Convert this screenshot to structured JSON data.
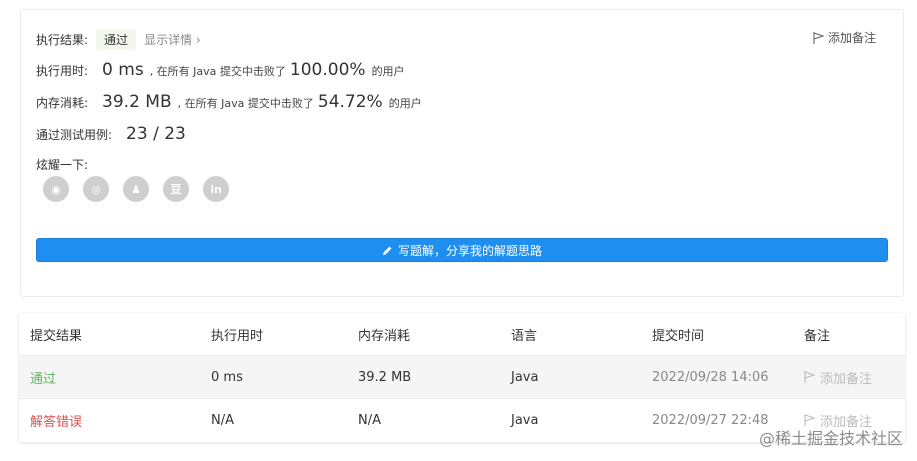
{
  "result": {
    "status_label": "执行结果:",
    "status_value": "通过",
    "details_link": "显示详情 ›",
    "add_note": "添加备注",
    "runtime_label": "执行用时:",
    "runtime_value": "0 ms",
    "runtime_beat_prefix": ", 在所有 Java 提交中击败了",
    "runtime_pct": "100.00%",
    "runtime_suffix": "的用户",
    "memory_label": "内存消耗:",
    "memory_value": "39.2 MB",
    "memory_beat_prefix": ", 在所有 Java 提交中击败了",
    "memory_pct": "54.72%",
    "memory_suffix": "的用户",
    "cases_label": "通过测试用例:",
    "cases_value": "23 / 23",
    "share_label": "炫耀一下:",
    "share_icons": [
      "wechat-icon",
      "weibo-icon",
      "qq-icon",
      "douban-icon",
      "linkedin-icon"
    ],
    "share_glyphs": [
      "◉",
      "◎",
      "♟",
      "豆",
      "in"
    ],
    "write_solution": "写题解，分享我的解题思路"
  },
  "table": {
    "headers": [
      "提交结果",
      "执行用时",
      "内存消耗",
      "语言",
      "提交时间",
      "备注"
    ],
    "rows": [
      {
        "result": "通过",
        "runtime": "0 ms",
        "memory": "39.2 MB",
        "lang": "Java",
        "time": "2022/09/28 14:06",
        "note": "添加备注"
      },
      {
        "result": "解答错误",
        "runtime": "N/A",
        "memory": "N/A",
        "lang": "Java",
        "time": "2022/09/27 22:48",
        "note": "添加备注"
      }
    ]
  },
  "watermark": "@稀土掘金技术社区",
  "colors": {
    "accent": "#1e8ff0",
    "success": "#5cb85c",
    "error": "#d9534f"
  }
}
